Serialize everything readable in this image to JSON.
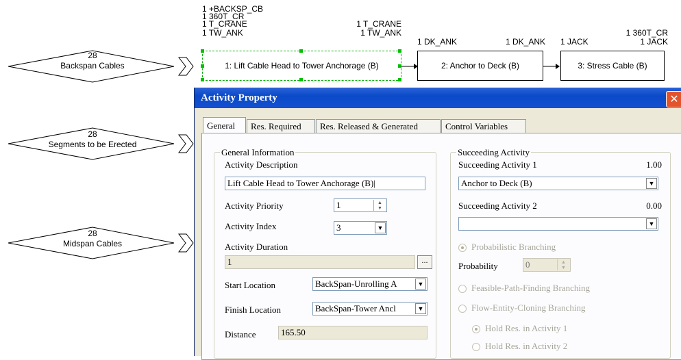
{
  "diagram": {
    "resources_top": [
      "1 +BACKSP_CB",
      "1 360T_CR",
      "1 T_CRANE",
      "1 TW_ANK"
    ],
    "res_node1_right": [
      "1 T_CRANE",
      "1 TW_ANK"
    ],
    "res_node2_left": "1 DK_ANK",
    "res_node2_right": "1 DK_ANK",
    "res_node3_left": "1 JACK",
    "res_node3_right": [
      "1 360T_CR",
      "1 JACK"
    ],
    "nodes": [
      {
        "label": "1: Lift Cable Head to Tower Anchorage (B)"
      },
      {
        "label": "2: Anchor to Deck (B)"
      },
      {
        "label": "3: Stress Cable (B)"
      }
    ],
    "queues": [
      {
        "count": "28",
        "label": "Backspan Cables"
      },
      {
        "count": "28",
        "label": "Segments to be Erected"
      },
      {
        "count": "28",
        "label": "Midspan Cables"
      }
    ]
  },
  "dialog": {
    "title": "Activity Property",
    "close_icon": "close-icon",
    "tabs": [
      "General",
      "Res. Required",
      "Res. Released & Generated",
      "Control Variables"
    ],
    "general_info": {
      "group_title": "General Information",
      "description_label": "Activity Description",
      "description_value": "Lift Cable Head to Tower Anchorage (B)|",
      "priority_label": "Activity Priority",
      "priority_value": "1",
      "index_label": "Activity Index",
      "index_value": "3",
      "duration_label": "Activity Duration",
      "duration_value": "1",
      "duration_button": "...",
      "start_label": "Start Location",
      "start_value": "BackSpan-Unrolling A",
      "finish_label": "Finish Location",
      "finish_value": "BackSpan-Tower Ancl",
      "distance_label": "Distance",
      "distance_value": "165.50"
    },
    "succeeding": {
      "group_title": "Succeeding Activity",
      "act1_label": "Succeeding Activity 1",
      "act1_prob": "1.00",
      "act1_value": "Anchor to Deck (B)",
      "act2_label": "Succeeding Activity 2",
      "act2_prob": "0.00",
      "act2_value": "",
      "prob_branching": "Probabilistic Branching",
      "probability_label": "Probability",
      "probability_value": "0",
      "feasible_branching": "Feasible-Path-Finding Branching",
      "cloning_branching": "Flow-Entity-Cloning Branching",
      "hold1": "Hold Res. in Activity 1",
      "hold2": "Hold Res. in Activity 2"
    }
  }
}
